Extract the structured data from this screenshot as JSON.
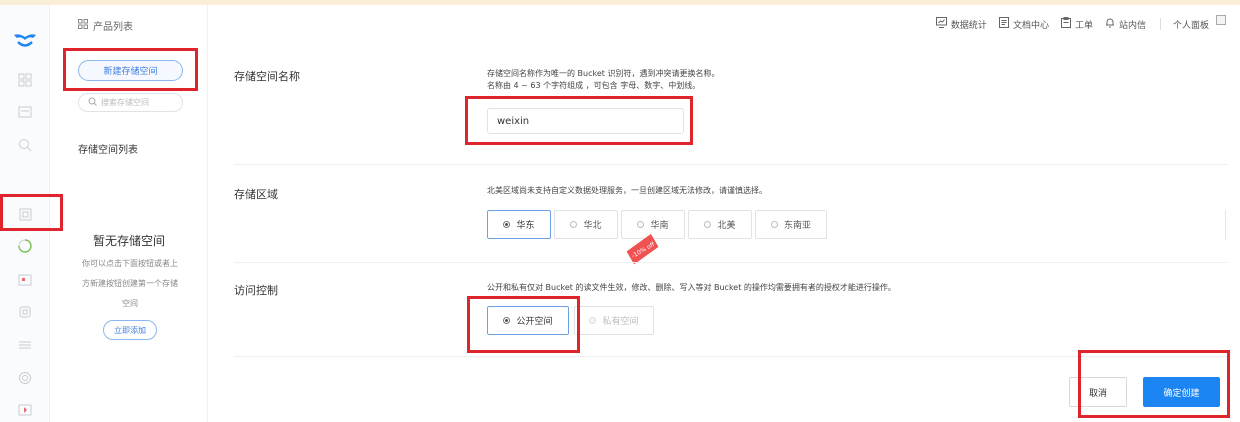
{
  "theme": {
    "accent": "#1b86f3",
    "highlight": "#e0242b",
    "top_strip": "#fbeed6"
  },
  "rail": {
    "logo": "brand-logo",
    "icons": [
      "grid-icon",
      "id-card-icon",
      "search-icon",
      "storage-icon",
      "gauge-icon",
      "media-icon",
      "chip-icon",
      "code-icon",
      "settings-icon",
      "play-icon"
    ]
  },
  "breadcrumb": {
    "icon": "grid-icon",
    "label": "产品列表"
  },
  "sidebar": {
    "new_button": "新建存储空间",
    "search_placeholder": "搜索存储空间",
    "list_title": "存储空间列表",
    "empty_title": "暂无存储空间",
    "empty_desc": "你可以点击下面按钮或者上方新建按钮创建第一个存储空间",
    "add_button": "立即添加"
  },
  "topnav": {
    "items": [
      {
        "icon": "chart-icon",
        "label": "数据统计"
      },
      {
        "icon": "document-icon",
        "label": "文档中心"
      },
      {
        "icon": "clipboard-icon",
        "label": "工单"
      },
      {
        "icon": "bell-icon",
        "label": "站内信"
      }
    ],
    "user_panel": "个人面板"
  },
  "form": {
    "name": {
      "label": "存储空间名称",
      "desc_line1": "存储空间名称作为唯一的 Bucket 识别符，遇到冲突请更换名称。",
      "desc_line2": "名称由 4 ~ 63 个字符组成 ，可包含 字母、数字、中划线。",
      "value": "weixin"
    },
    "region": {
      "label": "存储区域",
      "desc": "北美区域尚未支持自定义数据处理服务，一旦创建区域无法修改，请谨慎选择。",
      "options": [
        "华东",
        "华北",
        "华南",
        "北美",
        "东南亚"
      ],
      "selected": "华东",
      "promo_badge": "-10% off"
    },
    "access": {
      "label": "访问控制",
      "desc": "公开和私有仅对 Bucket 的读文件生效，修改、删除、写入等对 Bucket 的操作均需要拥有者的授权才能进行操作。",
      "options": [
        "公开空间",
        "私有空间"
      ],
      "selected": "公开空间"
    }
  },
  "actions": {
    "cancel": "取消",
    "confirm": "确定创建"
  }
}
